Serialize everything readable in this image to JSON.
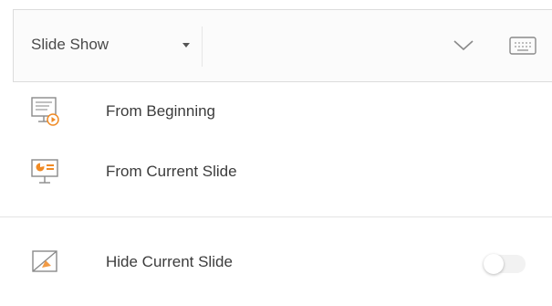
{
  "toolbar": {
    "dropdown_label": "Slide Show",
    "dropdown_icon": "caret-down-icon",
    "collapse_icon": "chevron-down-icon",
    "keyboard_icon": "keyboard-icon"
  },
  "menu": {
    "items": [
      {
        "label": "From Beginning",
        "icon": "slideshow-from-beginning-icon"
      },
      {
        "label": "From Current Slide",
        "icon": "slideshow-from-current-icon"
      },
      {
        "label": "Hide Current Slide",
        "icon": "hide-slide-icon",
        "toggle_on": false
      }
    ]
  },
  "colors": {
    "accent_orange": "#f08a24",
    "icon_gray": "#8a8a8a",
    "divider": "#e4e4e4"
  }
}
